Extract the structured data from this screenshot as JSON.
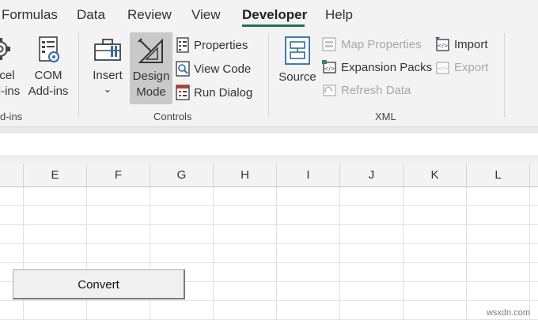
{
  "tabs": [
    "Formulas",
    "Data",
    "Review",
    "View",
    "Developer",
    "Help"
  ],
  "active_tab": "Developer",
  "ribbon": {
    "addins": {
      "excel_addins_line1": "cel",
      "excel_addins_line2": "d-ins",
      "com_addins_line1": "COM",
      "com_addins_line2": "Add-ins",
      "group_label": "d-ins"
    },
    "controls": {
      "insert_label": "Insert",
      "insert_arrow": "⌄",
      "design_mode_line1": "Design",
      "design_mode_line2": "Mode",
      "properties_label": "Properties",
      "view_code_label": "View Code",
      "run_dialog_label": "Run Dialog",
      "group_label": "Controls"
    },
    "xml": {
      "source_label": "Source",
      "map_properties_label": "Map Properties",
      "expansion_packs_label": "Expansion Packs",
      "refresh_data_label": "Refresh Data",
      "import_label": "Import",
      "export_label": "Export",
      "group_label": "XML"
    }
  },
  "columns": [
    "E",
    "F",
    "G",
    "H",
    "I",
    "J",
    "K",
    "L"
  ],
  "sheet_button_label": "Convert",
  "watermark": "wsxdn.com",
  "colors": {
    "accent": "#217346",
    "ribbon_bg": "#f3f3f3",
    "pressed": "#c9c9c9",
    "icon_blue": "#2b6cb0"
  }
}
